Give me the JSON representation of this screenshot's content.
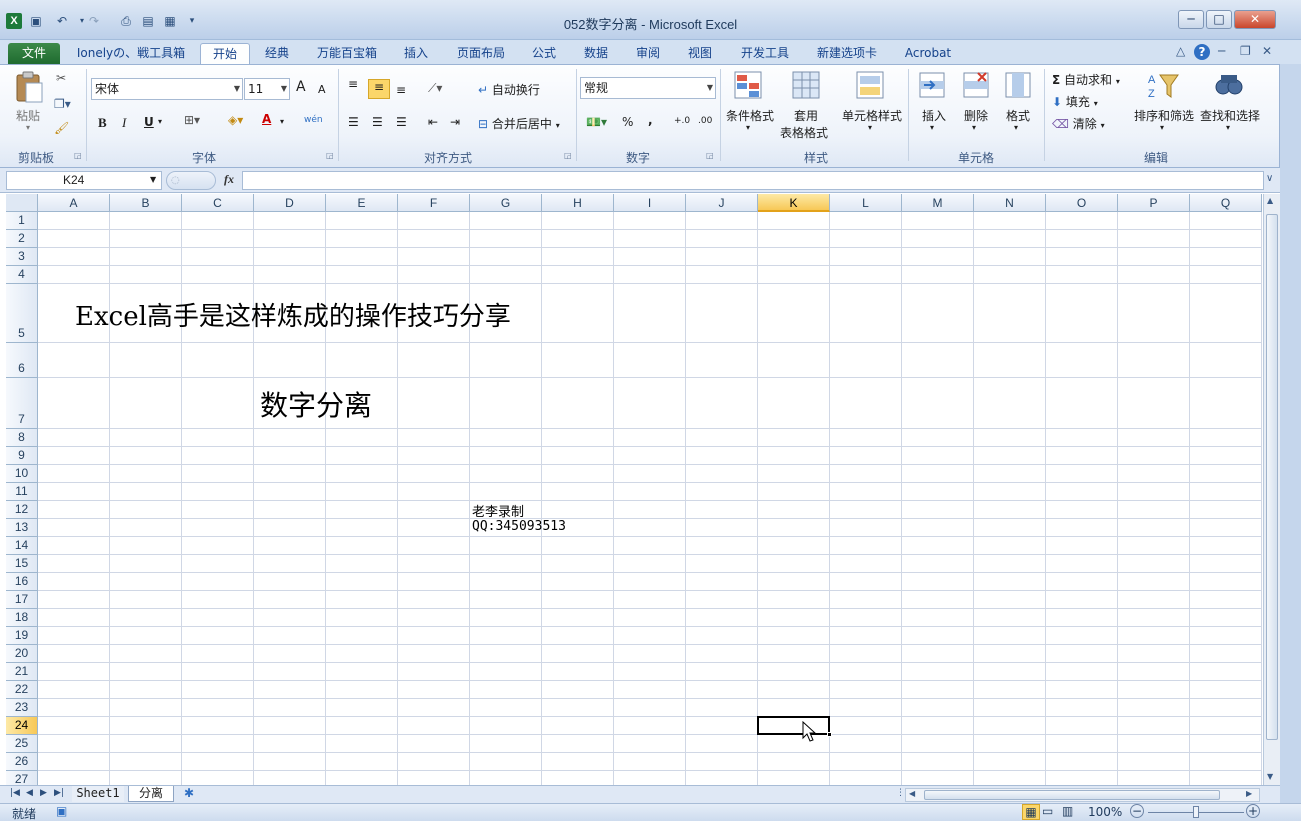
{
  "window": {
    "title": "052数字分离 - Microsoft Excel"
  },
  "tabs": [
    "文件",
    "Ionelyの、戦工具箱",
    "开始",
    "经典",
    "万能百宝箱",
    "插入",
    "页面布局",
    "公式",
    "数据",
    "审阅",
    "视图",
    "开发工具",
    "新建选项卡",
    "Acrobat"
  ],
  "ribbon": {
    "clipboard": {
      "paste": "粘贴",
      "label": "剪贴板"
    },
    "font": {
      "name": "宋体",
      "size": "11",
      "bold": "B",
      "italic": "I",
      "underline": "U",
      "grow": "A",
      "shrink": "A",
      "font_color": "A",
      "phonetic": "wén",
      "label": "字体"
    },
    "alignment": {
      "wrap": "自动换行",
      "merge": "合并后居中",
      "label": "对齐方式"
    },
    "number": {
      "format": "常规",
      "percent": "%",
      "comma": ",",
      "inc": "+.0",
      "dec": ".00",
      "label": "数字"
    },
    "styles": {
      "conditional": "条件格式",
      "table_line1": "套用",
      "table_line2": "表格格式",
      "cell_styles": "单元格样式",
      "label": "样式"
    },
    "cells": {
      "insert": "插入",
      "delete": "删除",
      "format": "格式",
      "label": "单元格"
    },
    "editing": {
      "autosum": "自动求和",
      "fill": "填充",
      "clear": "清除",
      "sort": "排序和筛选",
      "find": "查找和选择",
      "label": "编辑",
      "sigma": "Σ"
    }
  },
  "formula_bar": {
    "name_box": "K24",
    "fx": "fx",
    "value": ""
  },
  "columns": [
    "A",
    "B",
    "C",
    "D",
    "E",
    "F",
    "G",
    "H",
    "I",
    "J",
    "K",
    "L",
    "M",
    "N",
    "O",
    "P",
    "Q"
  ],
  "rows": [
    "1",
    "2",
    "3",
    "4",
    "5",
    "6",
    "7",
    "8",
    "9",
    "10",
    "11",
    "12",
    "13",
    "14",
    "15",
    "16",
    "17",
    "18",
    "19",
    "20",
    "21",
    "22",
    "23",
    "24",
    "25",
    "26",
    "27"
  ],
  "selected": {
    "column": "K",
    "row": "24"
  },
  "cells": {
    "B5": "Excel高手是这样炼成的操作技巧分享",
    "E7": "数字分离",
    "G12": "老李录制",
    "G13": "QQ:345093513"
  },
  "sheets": [
    "Sheet1",
    "分离"
  ],
  "active_sheet": "分离",
  "status": {
    "ready": "就绪",
    "zoom": "100%",
    "minus": "−",
    "plus": "+"
  },
  "zoom_level": 0.5
}
